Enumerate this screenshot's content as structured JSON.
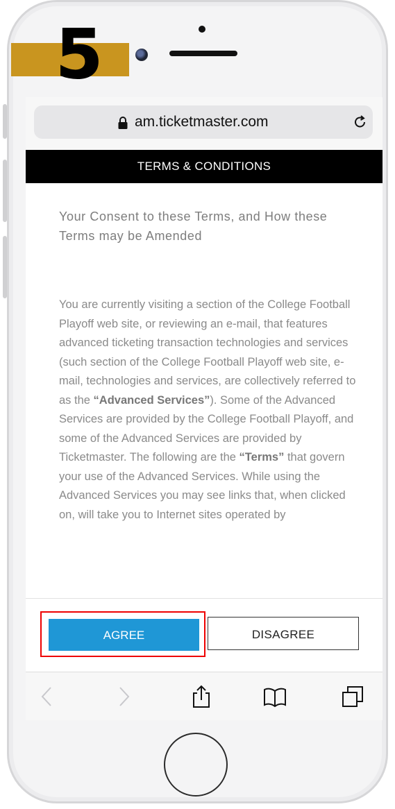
{
  "step": {
    "number": "5"
  },
  "browser": {
    "url": "am.ticketmaster.com"
  },
  "page": {
    "header": "TERMS & CONDITIONS",
    "heading": "Your Consent to these Terms, and How these Terms may be Amended",
    "body": {
      "p1": "You are currently visiting a section of the College Football Playoff web site, or reviewing an e-mail, that features advanced ticketing transaction technologies and services (such section of the College Football Playoff web site, e-mail, technologies and services, are collectively referred to as the ",
      "b1": "“Advanced Services”",
      "p2": "). Some of the Advanced Services are provided by the College Football Playoff, and some of the Advanced Services are provided by Ticketmaster. The following are the ",
      "b2": "“Terms”",
      "p3": " that govern your use of the Advanced Services. While using the Advanced Services you may see links that, when clicked on, will take you to Internet sites operated by"
    }
  },
  "buttons": {
    "agree": "AGREE",
    "disagree": "DISAGREE"
  },
  "colors": {
    "step_bar": "#c9951f",
    "agree_button": "#1f97d6",
    "highlight": "#e00000",
    "header_bg": "#000000"
  },
  "toolbar": {
    "icons": [
      "back-icon",
      "forward-icon",
      "share-icon",
      "bookmarks-icon",
      "tabs-icon"
    ]
  }
}
